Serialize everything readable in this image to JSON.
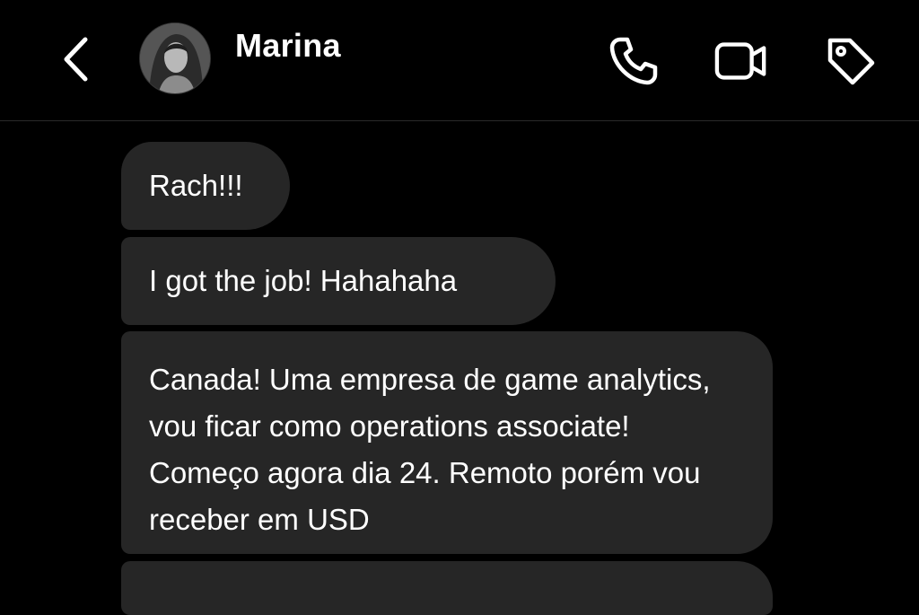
{
  "header": {
    "contact_name": "Marina",
    "icons": {
      "back": "chevron-left-icon",
      "call": "phone-icon",
      "video": "video-camera-icon",
      "tag": "tag-icon"
    }
  },
  "messages": [
    {
      "sender": "incoming",
      "text": "Rach!!!"
    },
    {
      "sender": "incoming",
      "text": "I got the job! Hahahaha"
    },
    {
      "sender": "incoming",
      "text": "Canada! Uma empresa de game analytics, vou ficar como operations associate! Começo agora dia 24. Remoto porém vou receber em USD"
    }
  ],
  "colors": {
    "background": "#000000",
    "bubble": "#262626",
    "text": "#ffffff"
  }
}
